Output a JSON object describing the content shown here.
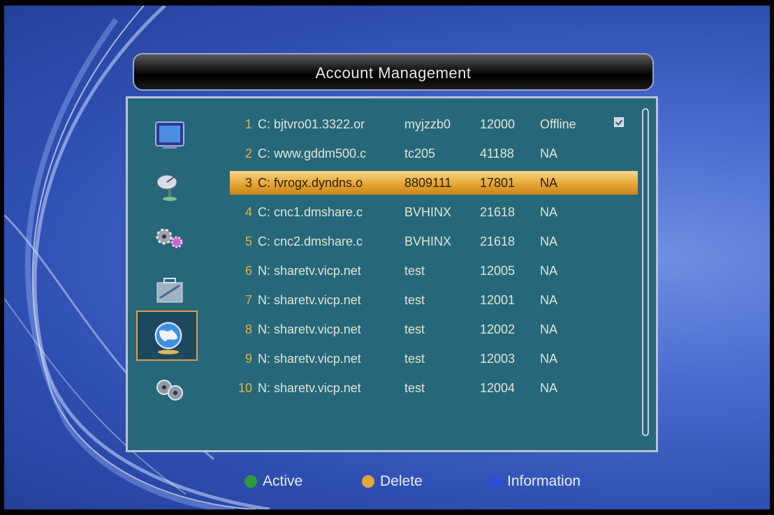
{
  "title": "Account Management",
  "accounts": [
    {
      "num": "1",
      "server": "C: bjtvro01.3322.or",
      "user": "myjzzb0",
      "port": "12000",
      "status": "Offline",
      "checked": true
    },
    {
      "num": "2",
      "server": "C: www.gddm500.c",
      "user": "tc205",
      "port": "41188",
      "status": "NA"
    },
    {
      "num": "3",
      "server": "C: fvrogx.dyndns.o",
      "user": "8809111",
      "port": "17801",
      "status": "NA",
      "selected": true
    },
    {
      "num": "4",
      "server": "C: cnc1.dmshare.c",
      "user": "BVHINX",
      "port": "21618",
      "status": "NA"
    },
    {
      "num": "5",
      "server": "C: cnc2.dmshare.c",
      "user": "BVHINX",
      "port": "21618",
      "status": "NA"
    },
    {
      "num": "6",
      "server": "N: sharetv.vicp.net",
      "user": "test",
      "port": "12005",
      "status": "NA"
    },
    {
      "num": "7",
      "server": "N: sharetv.vicp.net",
      "user": "test",
      "port": "12001",
      "status": "NA"
    },
    {
      "num": "8",
      "server": "N: sharetv.vicp.net",
      "user": "test",
      "port": "12002",
      "status": "NA"
    },
    {
      "num": "9",
      "server": "N: sharetv.vicp.net",
      "user": "test",
      "port": "12003",
      "status": "NA"
    },
    {
      "num": "10",
      "server": "N: sharetv.vicp.net",
      "user": "test",
      "port": "12004",
      "status": "NA"
    }
  ],
  "menu_icons": [
    "tv-icon",
    "satellite-dish-icon",
    "gears-icon",
    "toolbox-icon",
    "globe-icon",
    "film-reels-icon"
  ],
  "selected_menu": "globe-icon",
  "legend": [
    {
      "label": "Active",
      "color": "#2e9b3a"
    },
    {
      "label": "Delete",
      "color": "#e3a63a"
    },
    {
      "label": "Information",
      "color": "#2b4fd6"
    }
  ]
}
